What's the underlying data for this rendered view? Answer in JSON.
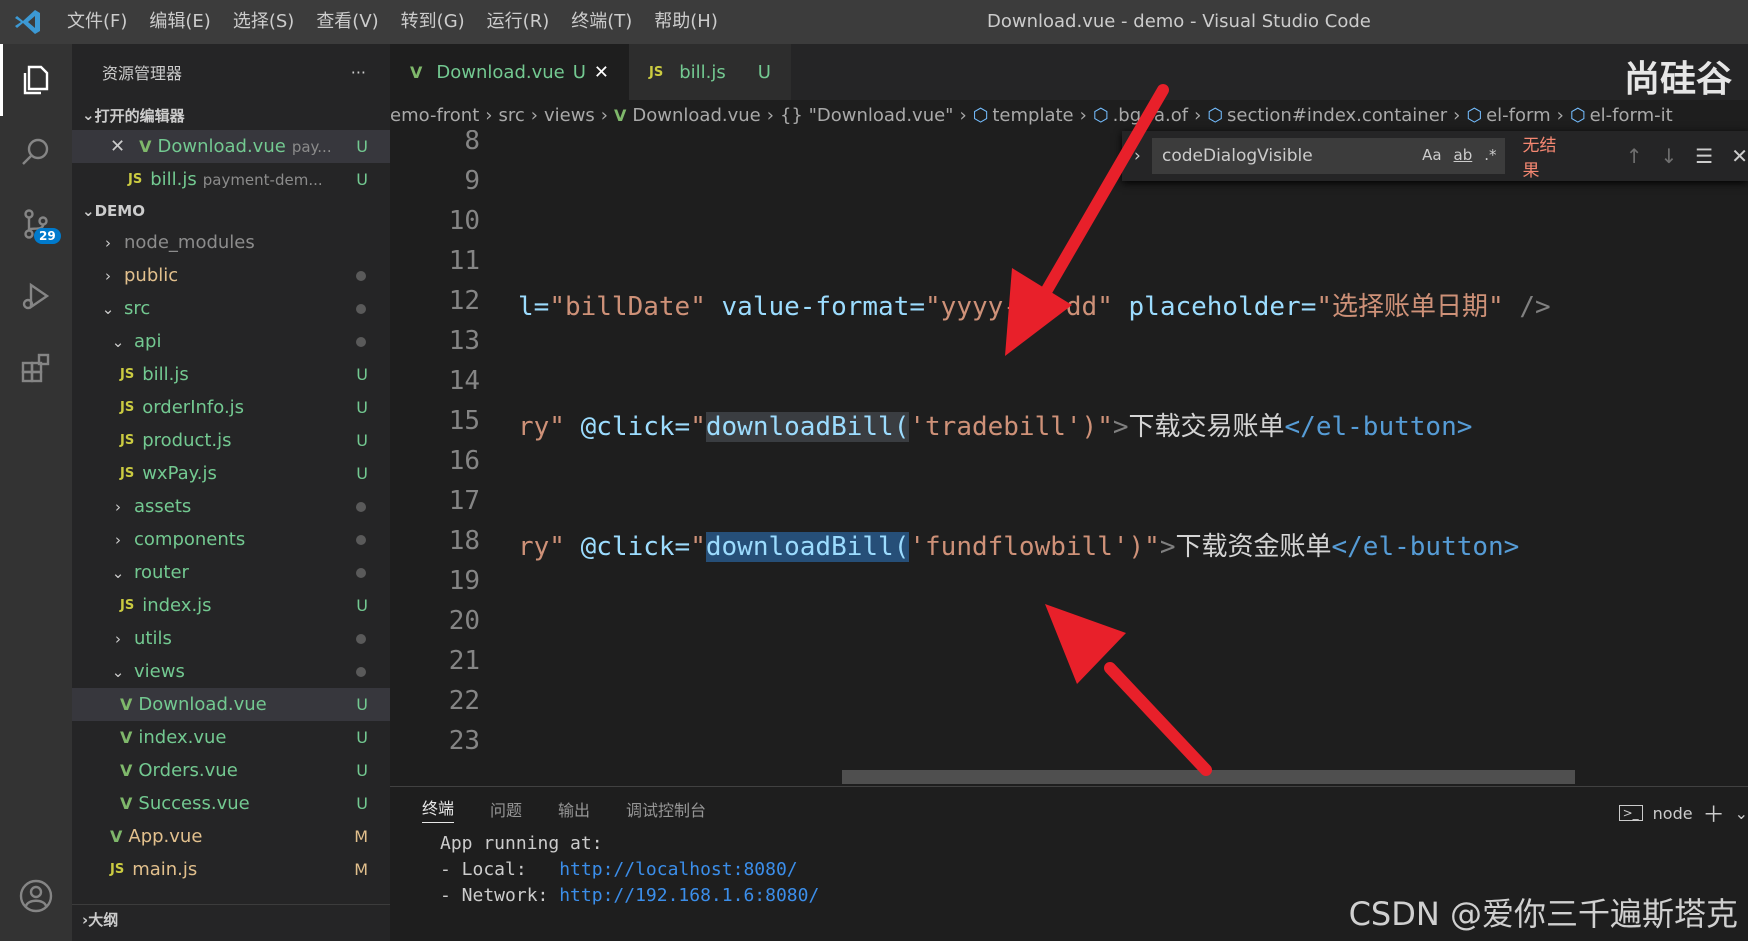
{
  "titlebar": {
    "menus": [
      "文件(F)",
      "编辑(E)",
      "选择(S)",
      "查看(V)",
      "转到(G)",
      "运行(R)",
      "终端(T)",
      "帮助(H)"
    ],
    "window_title": "Download.vue - demo - Visual Studio Code"
  },
  "activity": {
    "scm_badge": "29"
  },
  "sidebar": {
    "title": "资源管理器",
    "more": "···",
    "open_editors_label": "打开的编辑器",
    "open_editors": [
      {
        "name": "Download.vue",
        "desc": "pay...",
        "status": "U"
      },
      {
        "name": "bill.js",
        "desc": "payment-dem...",
        "status": "U"
      }
    ],
    "workspace_label": "DEMO",
    "tree": [
      {
        "name": "node_modules"
      },
      {
        "name": "public"
      },
      {
        "name": "src"
      },
      {
        "name": "api"
      },
      {
        "name": "bill.js",
        "status": "U"
      },
      {
        "name": "orderInfo.js",
        "status": "U"
      },
      {
        "name": "product.js",
        "status": "U"
      },
      {
        "name": "wxPay.js",
        "status": "U"
      },
      {
        "name": "assets"
      },
      {
        "name": "components"
      },
      {
        "name": "router"
      },
      {
        "name": "index.js",
        "status": "U"
      },
      {
        "name": "utils"
      },
      {
        "name": "views"
      },
      {
        "name": "Download.vue",
        "status": "U"
      },
      {
        "name": "index.vue",
        "status": "U"
      },
      {
        "name": "Orders.vue",
        "status": "U"
      },
      {
        "name": "Success.vue",
        "status": "U"
      },
      {
        "name": "App.vue",
        "status": "M"
      },
      {
        "name": "main.js",
        "status": "M"
      }
    ],
    "outline_label": "大纲"
  },
  "tabs": [
    {
      "name": "Download.vue",
      "status": "U",
      "close": "✕"
    },
    {
      "name": "bill.js",
      "status": "U"
    }
  ],
  "brand": "尚硅谷",
  "breadcrumb": [
    "emo-front",
    "src",
    "views",
    "Download.vue",
    "{} \"Download.vue\"",
    "template",
    ".bg-fa.of",
    "section#index.container",
    "el-form",
    "el-form-it"
  ],
  "find": {
    "query": "codeDialogVisible",
    "opt_case": "Aa",
    "opt_word": "ab",
    "opt_regex": ".*",
    "result": "无结果"
  },
  "line_numbers": [
    "8",
    "9",
    "10",
    "11",
    "12",
    "13",
    "14",
    "15",
    "16",
    "17",
    "18",
    "19",
    "20",
    "21",
    "22",
    "23"
  ],
  "code": {
    "l12": {
      "a": "l=",
      "b": "\"billDate\"",
      "c": " value-format=",
      "d": "\"yyyy-MM-dd\"",
      "e": " placeholder=",
      "f": "\"选择账单日期\"",
      "g": " />"
    },
    "l15": {
      "a": "ry\"",
      "b": " @click=",
      "q": "\"",
      "fn": "downloadBill(",
      "arg": "'tradebill'",
      "close": ")\"",
      "gt": ">",
      "text": "下载交易账单",
      "endtag": "</el-button>"
    },
    "l18": {
      "a": "ry\"",
      "b": " @click=",
      "q": "\"",
      "fn": "downloadBill(",
      "arg": "'fundflowbill'",
      "close": ")\"",
      "gt": ">",
      "text": "下载资金账单",
      "endtag": "</el-button>"
    }
  },
  "panel": {
    "tabs": [
      "终端",
      "问题",
      "输出",
      "调试控制台"
    ],
    "shell": "node",
    "terminal": {
      "line1": "App running at:",
      "local_label": "- Local:   ",
      "local_url": "http://localhost:8080/",
      "network_label": "- Network: ",
      "network_url": "http://192.168.1.6:8080/"
    }
  },
  "watermark": "CSDN @爱你三千遍斯塔克"
}
